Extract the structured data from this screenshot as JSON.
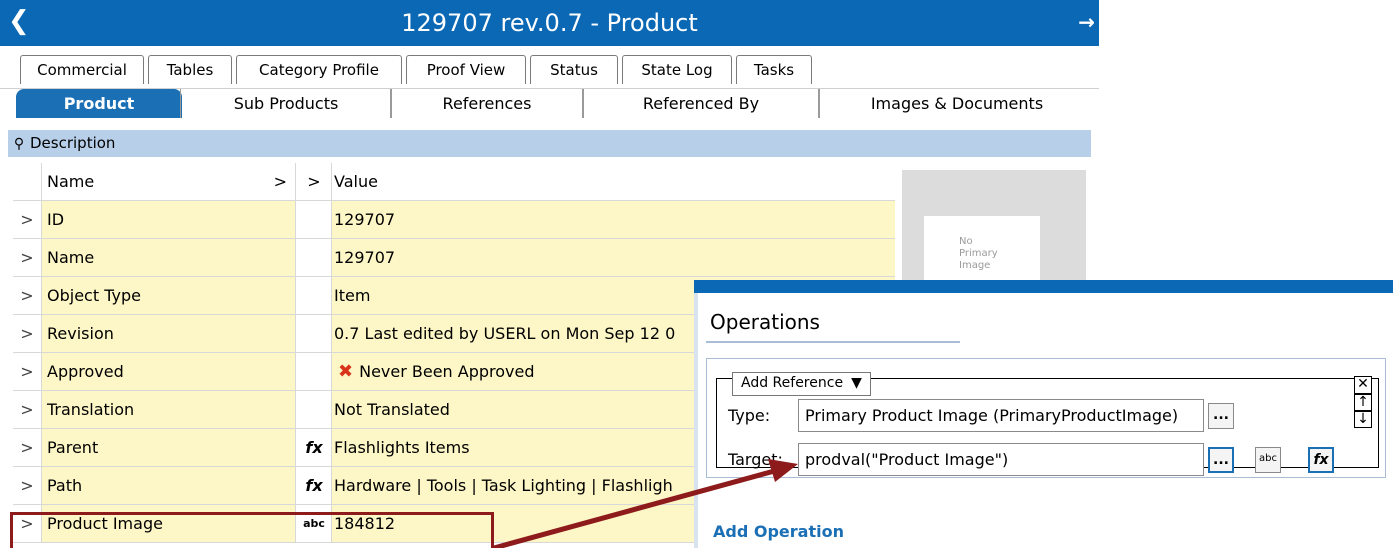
{
  "window": {
    "back_icon": "chevron-left-icon",
    "title": "129707 rev.0.7 - Product",
    "pin_icon": "pin-icon"
  },
  "tabs_top": [
    {
      "label": "Commercial"
    },
    {
      "label": "Tables"
    },
    {
      "label": "Category Profile"
    },
    {
      "label": "Proof View"
    },
    {
      "label": "Status"
    },
    {
      "label": "State Log"
    },
    {
      "label": "Tasks"
    }
  ],
  "tabs_main": [
    {
      "label": "Product",
      "active": true
    },
    {
      "label": "Sub Products"
    },
    {
      "label": "References"
    },
    {
      "label": "Referenced By"
    },
    {
      "label": "Images & Documents"
    }
  ],
  "section": {
    "label": "Description",
    "icon": "pin-icon"
  },
  "grid": {
    "header": {
      "name": "Name",
      "sort1": ">",
      "sort2": ">",
      "value": "Value"
    },
    "rows": [
      {
        "exp": ">",
        "name": "ID",
        "fx": "",
        "value": "129707"
      },
      {
        "exp": ">",
        "name": "Name",
        "fx": "",
        "value": "129707"
      },
      {
        "exp": ">",
        "name": "Object Type",
        "fx": "",
        "value": "Item"
      },
      {
        "exp": ">",
        "name": "Revision",
        "fx": "",
        "value": "0.7 Last edited by USERL on Mon Sep 12 0"
      },
      {
        "exp": ">",
        "name": "Approved",
        "fx": "",
        "value": "Never Been Approved"
      },
      {
        "exp": ">",
        "name": "Translation",
        "fx": "",
        "value": "Not Translated"
      },
      {
        "exp": ">",
        "name": "Parent",
        "fx": "fx",
        "value": "Flashlights Items"
      },
      {
        "exp": ">",
        "name": "Path",
        "fx": "fx",
        "value": "Hardware | Tools | Task Lighting | Flashligh"
      },
      {
        "exp": ">",
        "name": "Product Image",
        "fx": "abc",
        "value": "184812"
      }
    ]
  },
  "thumbnail": {
    "text_line1": "No",
    "text_line2": "Primary",
    "text_line3": "Image"
  },
  "operations": {
    "heading": "Operations",
    "dropdown": "Add Reference",
    "type_label": "Type:",
    "type_value": "Primary Product Image (PrimaryProductImage)",
    "target_label": "Target:",
    "target_value": "prodval(\"Product Image\")",
    "ellipsis": "...",
    "abc": "abc",
    "fx": "fx",
    "close_icon": "close-icon",
    "up_icon": "arrow-up-icon",
    "down_icon": "arrow-down-icon",
    "add_operation": "Add Operation"
  },
  "colors": {
    "titlebar": "#0b68b5",
    "row_value_bg": "#fdf6c6",
    "section_bg": "#b8cfea",
    "highlight": "#8e1b1b"
  }
}
